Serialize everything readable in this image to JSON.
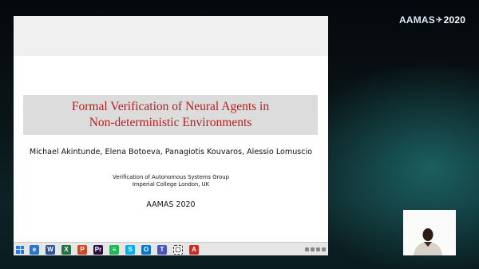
{
  "brand": {
    "name": "AAMAS",
    "year": "2020"
  },
  "slide": {
    "title_line1": "Formal Verification of Neural Agents in",
    "title_line2": "Non-deterministic Environments",
    "authors": "Michael Akintunde, Elena Botoeva, Panagiotis Kouvaros, Alessio Lomuscio",
    "group_line1": "Verification of Autonomous Systems Group",
    "group_line2": "Imperial College London, UK",
    "conference": "AAMAS 2020"
  },
  "taskbar": {
    "icons": [
      {
        "name": "ie-icon",
        "glyph": "e",
        "color": "#2a74c9"
      },
      {
        "name": "word-icon",
        "glyph": "W",
        "color": "#2b579a"
      },
      {
        "name": "excel-icon",
        "glyph": "X",
        "color": "#217346"
      },
      {
        "name": "powerpoint-icon",
        "glyph": "P",
        "color": "#d24726"
      },
      {
        "name": "premiere-icon",
        "glyph": "Pr",
        "color": "#2a0e44"
      },
      {
        "name": "spotify-icon",
        "glyph": "≡",
        "color": "#1db954"
      },
      {
        "name": "skype-icon",
        "glyph": "S",
        "color": "#00aff0"
      },
      {
        "name": "outlook-icon",
        "glyph": "O",
        "color": "#0078d4"
      },
      {
        "name": "teams-icon",
        "glyph": "T",
        "color": "#4b53bc"
      },
      {
        "name": "screen-clip-icon",
        "glyph": "▢",
        "color": "#333333"
      },
      {
        "name": "pdf-icon",
        "glyph": "A",
        "color": "#d02b1f"
      }
    ]
  }
}
